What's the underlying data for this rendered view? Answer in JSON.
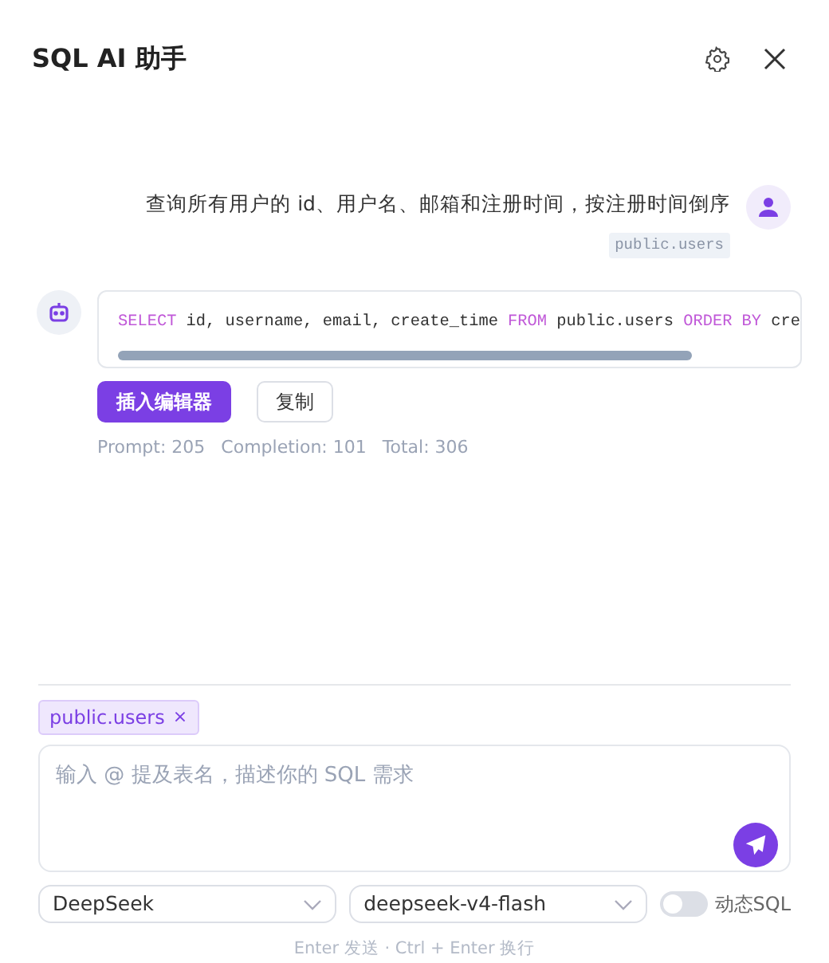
{
  "window": {
    "title": "SQL AI 助手"
  },
  "messages": [
    {
      "kind": "user",
      "text": "查询所有用户的 id、用户名、邮箱和注册时间，按注册时间倒序",
      "tables": [
        "public.users"
      ]
    },
    {
      "kind": "assistant",
      "code": [
        {
          "kind": "keyword",
          "text": "SELECT"
        },
        {
          "kind": "plain",
          "text": " id, username, email, create_time "
        },
        {
          "kind": "keyword",
          "text": "FROM"
        },
        {
          "kind": "plain",
          "text": " public.users "
        },
        {
          "kind": "keyword",
          "text": "ORDER BY"
        },
        {
          "kind": "plain",
          "text": " cre"
        }
      ],
      "actions": [
        {
          "kind": "primary",
          "label": "插入编辑器"
        },
        {
          "kind": "secondary",
          "label": "复制"
        }
      ],
      "usage": [
        "Prompt: 205",
        "Completion: 101",
        "Total: 306"
      ]
    }
  ],
  "composer": {
    "tags": [
      {
        "label": "public.users",
        "remove": "×"
      }
    ],
    "placeholder": "输入 @ 提及表名，描述你的 SQL 需求",
    "provider": "DeepSeek",
    "model": "deepseek-v4-flash",
    "toggle": {
      "label": "动态SQL",
      "on": false
    },
    "hint": "Enter 发送 · Ctrl + Enter 换行"
  }
}
